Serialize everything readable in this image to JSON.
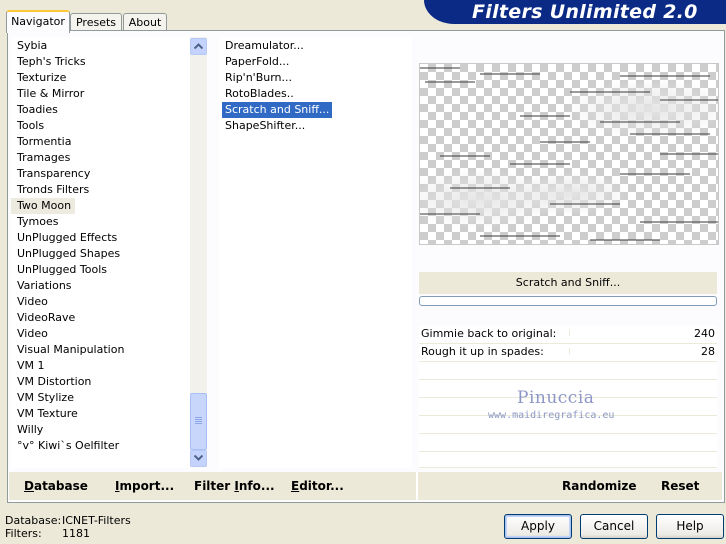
{
  "tabs": [
    {
      "label": "Navigator",
      "active": true
    },
    {
      "label": "Presets",
      "active": false
    },
    {
      "label": "About",
      "active": false
    }
  ],
  "app_title": "Filters Unlimited 2.0",
  "categories": [
    "Sybia",
    "Teph's Tricks",
    "Texturize",
    "Tile & Mirror",
    "Toadies",
    "Tools",
    "Tormentia",
    "Tramages",
    "Transparency",
    "Tronds Filters",
    "Two Moon",
    "Tymoes",
    "UnPlugged Effects",
    "UnPlugged Shapes",
    "UnPlugged Tools",
    "Variations",
    "Video",
    "VideoRave",
    "Video",
    "Visual Manipulation",
    "VM 1",
    "VM Distortion",
    "VM Stylize",
    "VM Texture",
    "Willy",
    "°v° Kiwi`s Oelfilter"
  ],
  "selected_category": "Two Moon",
  "filters": [
    "Dreamulator...",
    "PaperFold...",
    "Rip'n'Burn...",
    "RotoBlades..",
    "Scratch and Sniff...",
    "ShapeShifter..."
  ],
  "selected_filter": "Scratch and Sniff...",
  "preview": {
    "filter_name": "Scratch and Sniff..."
  },
  "params": [
    {
      "label": "Gimmie back to original:",
      "value": "240"
    },
    {
      "label": "Rough it up in spades:",
      "value": "28"
    }
  ],
  "watermark": {
    "name": "Pinuccia",
    "url": "www.maidiregrafica.eu"
  },
  "buttons": {
    "database": {
      "label": "Database",
      "key": "D",
      "rest": "atabase"
    },
    "import": {
      "label": "Import...",
      "key": "I",
      "rest": "mport..."
    },
    "filter_info": {
      "label": "Filter Info...",
      "pre": "Filter ",
      "key": "I",
      "rest": "nfo..."
    },
    "editor": {
      "label": "Editor...",
      "key": "E",
      "rest": "ditor..."
    },
    "randomize": "Randomize",
    "reset": "Reset",
    "apply": "Apply",
    "cancel": "Cancel",
    "help": "Help"
  },
  "status": {
    "database_label": "Database:",
    "database_value": "ICNET-Filters",
    "filters_label": "Filters:",
    "filters_value": "1181"
  },
  "scrollbar": {
    "position": 0.91
  }
}
